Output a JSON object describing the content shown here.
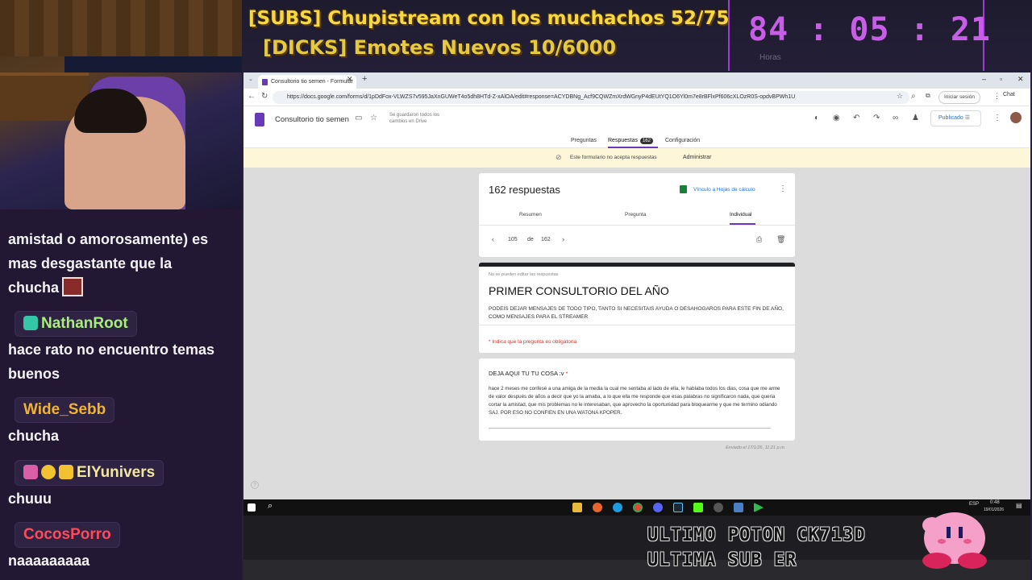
{
  "overlay": {
    "goal_subs": "[SUBS] Chupistream con los muchachos 52/75",
    "goal_dicks": "[DICKS] Emotes Nuevos 10/6000",
    "timer": "84 : 05 : 21",
    "timer_label_hours": "Horas"
  },
  "chat": {
    "messages": [
      {
        "text_lines": [
          "amistad o amorosamente) es",
          "mas desgastante que la",
          "chucha"
        ]
      },
      {
        "user": "NathanRoot",
        "user_color": "#a6f07a",
        "text_lines": [
          "hace rato no encuentro temas",
          "buenos"
        ]
      },
      {
        "user": "Wide_Sebb",
        "user_color": "#f2b233",
        "text_lines": [
          "chucha"
        ]
      },
      {
        "user": "ElYunivers",
        "user_color": "#f3e7a0",
        "text_lines": [
          "chuuu"
        ]
      },
      {
        "user": "CocosPorro",
        "user_color": "#ff4a5a",
        "text_lines": [
          "naaaaaaaaa"
        ]
      }
    ]
  },
  "browser": {
    "tab_title": "Consultorio tio semen - Formular",
    "url": "https://docs.google.com/forms/d/1pDdFox-VLWZS7v595JaXnGUWeT4o5dh8HTd-Z-xAlOA/edit#response=ACYDBNg_Acf9CQWZmXrdWGnyP4dEUtYQ1O6Yl0m7e8rBFlxPf606cXLOzR0S-opdvBPWh1U",
    "sign_in": "Iniciar sesión",
    "chat_label": "Chat",
    "form_name": "Consultorio tio semen",
    "saved_note": "Se guardaron todos los cambios en Drive",
    "publish_label": "Publicado",
    "tabs": {
      "questions": "Preguntas",
      "responses": "Respuestas",
      "responses_count": "162",
      "settings": "Configuración"
    },
    "banner_text": "Este formulario no acepta respuestas",
    "banner_admin": "Administrar"
  },
  "responses": {
    "count_title": "162 respuestas",
    "sheets_link": "Vínculo a Hojas de cálculo",
    "subtabs": {
      "summary": "Resumen",
      "question": "Pregunta",
      "individual": "Individual"
    },
    "current": "105",
    "of_label": "de",
    "total": "162"
  },
  "form": {
    "no_edit": "No se pueden editar las respuestas",
    "title": "PRIMER CONSULTORIO DEL AÑO",
    "description": "PODEIS DEJAR MENSAJES DE TODO TIPO, TANTO SI NECESITAIS AYUDA O DESAHOGAROS PARA ESTE FIN DE AÑO, COMO MENSAJES PARA EL STREAMER",
    "required_note": "* Indica que la pregunta es obligatoria",
    "question": "DEJA AQUI TU TU COSA :v",
    "required_star": "*",
    "answer": "hace 2 meses me confesé a una amiga de la media la cual me sentaba al lado de ella, le hablaba todos los dias, cosa que me arme de valor después de años a decir que yo la amaba, a lo que ella me responde que esas palabras no significaron nada, que queria cortar la amistad, que mis problemas no le interesaban, que aprovecho la oportunidad para bloquearme y que me termino odiando SAJ. POR ESO NO CONFIEN EN UNA WATONA KPOPER.",
    "sent": "Enviado el 17/1/26, 11:21 p.m."
  },
  "taskbar": {
    "lang": "ESP",
    "time": "0:48",
    "date": "19/01/2026"
  },
  "alerts": {
    "last_donation": "ULTIMO POTON CK713D",
    "last_sub": "ULTIMA SUB ER"
  }
}
